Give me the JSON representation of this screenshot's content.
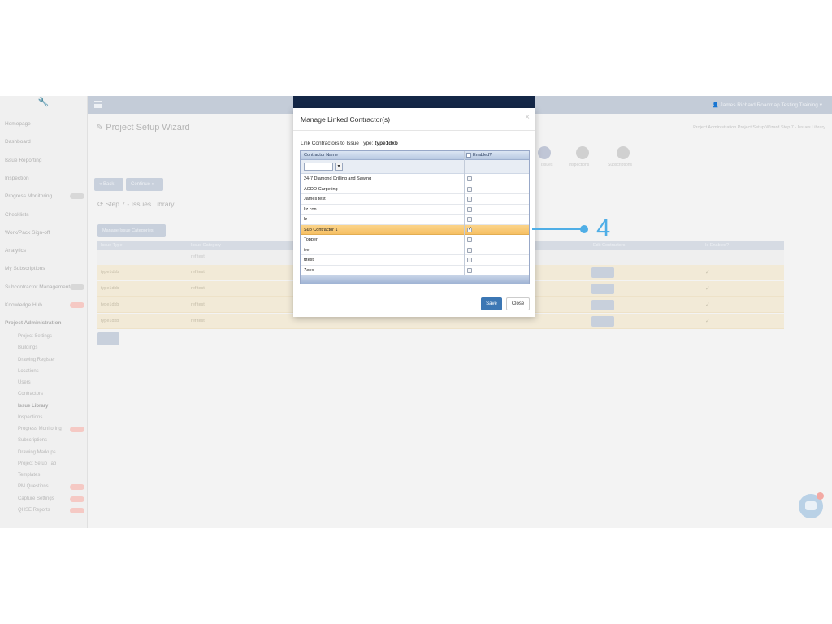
{
  "app": {
    "sidebar": {
      "items": [
        "Homepage",
        "Dashboard",
        "Issue Reporting",
        "Inspection",
        "Progress Monitoring",
        "Checklists",
        "Work/Pack Sign-off",
        "Analytics",
        "My Subscriptions",
        "Subcontractor Management",
        "Knowledge Hub",
        "Project Administration"
      ],
      "sub_items": [
        "Project Settings",
        "Buildings",
        "Drawing Register",
        "Locations",
        "Users",
        "Contractors",
        "Issue Library",
        "Inspections",
        "Progress Monitoring",
        "Subscriptions",
        "Drawing Markups",
        "Project Setup Tab",
        "Templates",
        "PM Questions",
        "Capture Settings",
        "QHSE Reports"
      ]
    },
    "user_name": "James Richard Roadmap Testing Training",
    "page_title": "Project Setup Wizard",
    "breadcrumbs": "Project Administration   Project Setup Wizard   Step 7 - Issues Library",
    "steps": [
      "Issues",
      "Inspections",
      "Subscriptions"
    ],
    "back_button": "Back",
    "continue_button": "Continue",
    "step_title": "Step 7 - Issues Library",
    "manage_button": "Manage Issue Categories",
    "table": {
      "columns": [
        "Issue Type",
        "Issue Category",
        "Edit Contractors",
        "Is Enabled?"
      ],
      "filter_value": "ref test",
      "rows": [
        {
          "type": "type1dxb",
          "category": "ref test"
        },
        {
          "type": "type1dxb",
          "category": "ref test"
        },
        {
          "type": "type1dxb",
          "category": "ref test"
        },
        {
          "type": "type1dxb",
          "category": "ref test"
        }
      ],
      "row_button": "Show",
      "check_mark": "✓"
    }
  },
  "modal": {
    "title": "Manage Linked Contractor(s)",
    "close_icon": "×",
    "link_label_prefix": "Link Contractors to Issue Type: ",
    "issue_type": "type1dxb",
    "grid": {
      "col_name": "Contractor Name",
      "col_enabled": "Enabled?",
      "filter_icon": "▾",
      "rows": [
        {
          "name": "24-7 Diamond Drilling and Sawing",
          "enabled": false,
          "selected": false
        },
        {
          "name": "AODO Carpeting",
          "enabled": false,
          "selected": false
        },
        {
          "name": "James test",
          "enabled": false,
          "selected": false
        },
        {
          "name": "liz con",
          "enabled": false,
          "selected": false
        },
        {
          "name": "lz",
          "enabled": false,
          "selected": false
        },
        {
          "name": "Sub Contractor 1",
          "enabled": true,
          "selected": true
        },
        {
          "name": "Topper",
          "enabled": false,
          "selected": false
        },
        {
          "name": "tre",
          "enabled": false,
          "selected": false
        },
        {
          "name": "tttest",
          "enabled": false,
          "selected": false
        },
        {
          "name": "Zeus",
          "enabled": false,
          "selected": false
        }
      ]
    },
    "save_label": "Save",
    "close_label": "Close"
  },
  "callout": {
    "number": "4"
  },
  "colors": {
    "accent": "#4faee6",
    "save": "#3c77b4",
    "selected_row": "#f6c064",
    "modal_top": "#142747"
  }
}
